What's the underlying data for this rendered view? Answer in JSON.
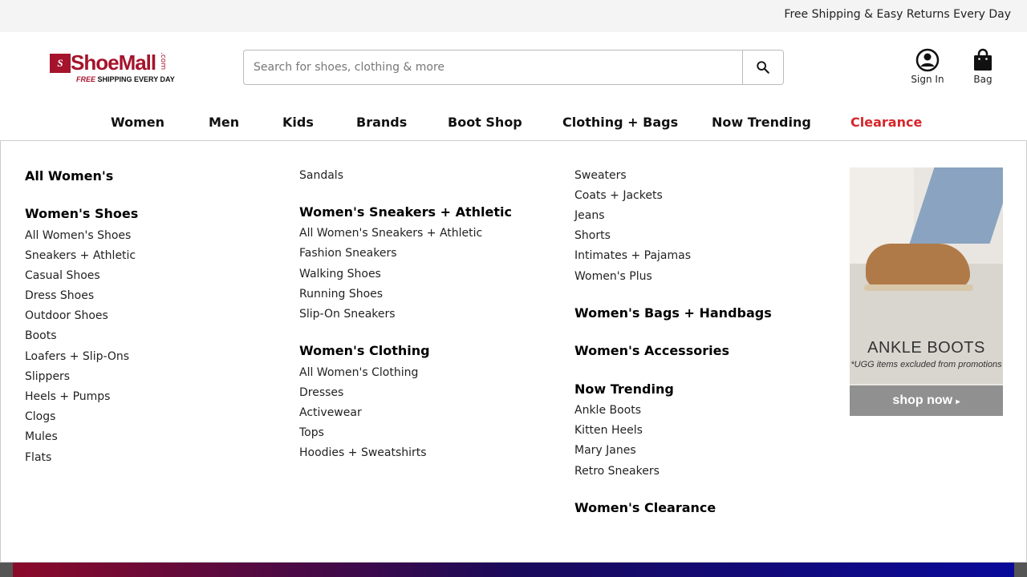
{
  "topbar": {
    "promo": "Free Shipping & Easy Returns Every Day"
  },
  "logo": {
    "word": "ShoeMall",
    "com": ".com",
    "tag_free": "FREE",
    "tag_rest": "SHIPPING EVERY DAY"
  },
  "search": {
    "placeholder": "Search for shoes, clothing & more",
    "icon": "search-icon"
  },
  "account": {
    "signin_label": "Sign In",
    "bag_label": "Bag"
  },
  "nav": {
    "items": [
      "Women",
      "Men",
      "Kids",
      "Brands",
      "Boot Shop",
      "Clothing + Bags",
      "Now Trending",
      "Clearance"
    ],
    "active": "Women",
    "clearance_color": "#d5262a"
  },
  "menu": {
    "col1": {
      "all_women": "All Women's",
      "shoes_head": "Women's Shoes",
      "shoes": [
        "All Women's Shoes",
        "Sneakers + Athletic",
        "Casual Shoes",
        "Dress Shoes",
        "Outdoor Shoes",
        "Boots",
        "Loafers + Slip-Ons",
        "Slippers",
        "Heels + Pumps",
        "Clogs",
        "Mules",
        "Flats"
      ]
    },
    "col2": {
      "sandals": "Sandals",
      "sneakers_head": "Women's Sneakers + Athletic",
      "sneakers": [
        "All Women's Sneakers + Athletic",
        "Fashion Sneakers",
        "Walking Shoes",
        "Running Shoes",
        "Slip-On Sneakers"
      ],
      "clothing_head": "Women's Clothing",
      "clothing": [
        "All Women's Clothing",
        "Dresses",
        "Activewear",
        "Tops",
        "Hoodies + Sweatshirts"
      ]
    },
    "col3": {
      "clothing_cont": [
        "Sweaters",
        "Coats + Jackets",
        "Jeans",
        "Shorts",
        "Intimates + Pajamas",
        "Women's Plus"
      ],
      "bags_head": "Women's Bags + Handbags",
      "accessories_head": "Women's Accessories",
      "trending_head": "Now Trending",
      "trending": [
        "Ankle Boots",
        "Kitten Heels",
        "Mary Janes",
        "Retro Sneakers"
      ],
      "clearance_head": "Women's Clearance"
    },
    "promo": {
      "title": "ANKLE BOOTS",
      "note": "*UGG items excluded from promotions",
      "cta": "shop now"
    }
  }
}
